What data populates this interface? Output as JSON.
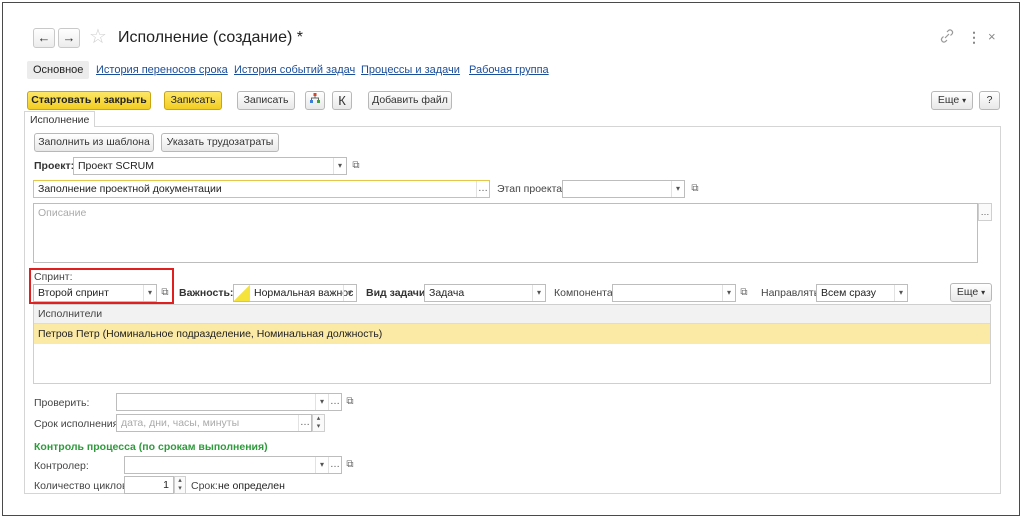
{
  "window": {
    "title": "Исполнение (создание) *",
    "back_glyph": "←",
    "forward_glyph": "→",
    "link_glyph": "🔗",
    "more_glyph": "⋮",
    "close_glyph": "×"
  },
  "tabs": [
    {
      "label": "Основное",
      "active": true
    },
    {
      "label": "История переносов срока"
    },
    {
      "label": "История событий задач"
    },
    {
      "label": "Процессы и задачи"
    },
    {
      "label": "Рабочая группа"
    }
  ],
  "toolbar": {
    "start_close": "Стартовать и закрыть",
    "save_yellow": "Записать",
    "save": "Записать",
    "k_label": "К",
    "add_file": "Добавить файл",
    "more": "Еще",
    "help": "?"
  },
  "group": {
    "tab_label": "Исполнение",
    "fill_template": "Заполнить из шаблона",
    "set_labor": "Указать трудозатраты"
  },
  "form": {
    "project_label": "Проект:",
    "project_value": "Проект SCRUM",
    "task_name_value": "Заполнение проектной документации",
    "stage_label": "Этап проекта:",
    "description_placeholder": "Описание",
    "sprint_label": "Спринт:",
    "sprint_value": "Второй спринт",
    "importance_label": "Важность:",
    "importance_value": "Нормальная важнос",
    "task_type_label": "Вид задачи:",
    "task_type_value": "Задача",
    "component_label": "Компонента:",
    "direct_label": "Направлять:",
    "direct_value": "Всем сразу",
    "more_label": "Еще",
    "executors_header": "Исполнители",
    "executor_row": "Петров Петр (Номинальное подразделение, Номинальная должность)",
    "check_label": "Проверить:",
    "deadline_label": "Срок исполнения:",
    "deadline_placeholder": "дата, дни, часы, минуты",
    "control_header": "Контроль процесса (по срокам выполнения)",
    "controller_label": "Контролер:",
    "cycles_label": "Количество циклов:",
    "cycles_value": "1",
    "term_label": "Срок:",
    "term_value": "не определен"
  },
  "colors": {
    "accent_yellow": "#f2cd21",
    "link_blue": "#1a4e9c",
    "highlight_row": "#fbe9a6",
    "section_green": "#2f9a3c",
    "sprint_outline": "#e02020"
  }
}
